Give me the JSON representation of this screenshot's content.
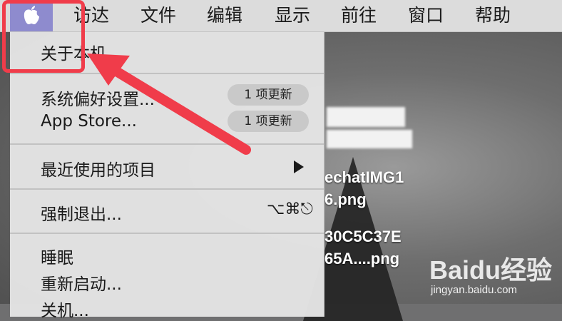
{
  "menubar": {
    "apple_icon": "apple-logo",
    "items": [
      "访达",
      "文件",
      "编辑",
      "显示",
      "前往",
      "窗口",
      "帮助"
    ]
  },
  "apple_menu": {
    "about": "关于本机",
    "system_prefs": "系统偏好设置...",
    "system_prefs_badge": "1 项更新",
    "app_store": "App Store...",
    "app_store_badge": "1 项更新",
    "recent_items": "最近使用的项目",
    "force_quit": "强制退出...",
    "force_quit_shortcut": "⌥⌘⎋",
    "sleep": "睡眠",
    "restart": "重新启动...",
    "shutdown": "关机..."
  },
  "desktop": {
    "file1_line1": "echatIMG1",
    "file1_line2": "6.png",
    "file2_line1": "30C5C37E",
    "file2_line2": "65A....png"
  },
  "watermark": {
    "logo": "Baidu经验",
    "url": "jingyan.baidu.com"
  },
  "colors": {
    "apple_highlight": "#8e8bce",
    "annotation_red": "#f03c4a"
  }
}
